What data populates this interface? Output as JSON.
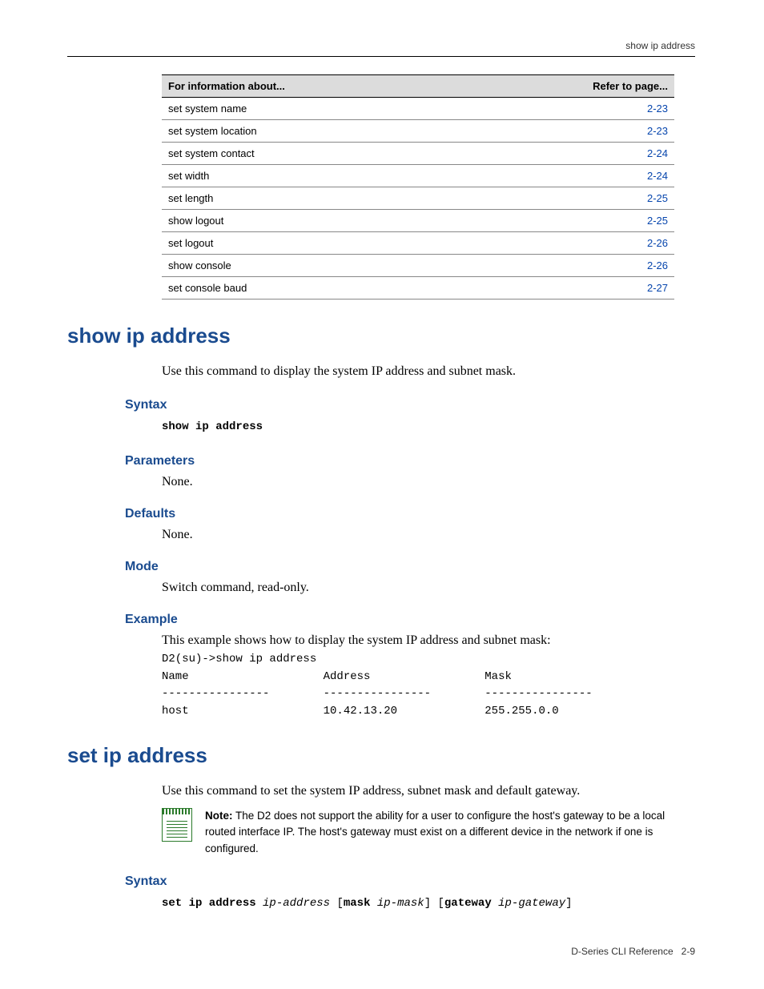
{
  "header": {
    "running_head": "show ip address"
  },
  "ref_table": {
    "col1": "For information about...",
    "col2": "Refer to page...",
    "rows": [
      {
        "info": "set system name",
        "page": "2-23"
      },
      {
        "info": "set system location",
        "page": "2-23"
      },
      {
        "info": "set system contact",
        "page": "2-24"
      },
      {
        "info": "set width",
        "page": "2-24"
      },
      {
        "info": "set length",
        "page": "2-25"
      },
      {
        "info": "show logout",
        "page": "2-25"
      },
      {
        "info": "set logout",
        "page": "2-26"
      },
      {
        "info": "show console",
        "page": "2-26"
      },
      {
        "info": "set console baud",
        "page": "2-27"
      }
    ]
  },
  "sections": {
    "show_ip": {
      "title": "show ip address",
      "desc": "Use this command to display the system IP address and subnet mask.",
      "syntax_h": "Syntax",
      "syntax_code": "show ip address",
      "params_h": "Parameters",
      "params_body": "None.",
      "defaults_h": "Defaults",
      "defaults_body": "None.",
      "mode_h": "Mode",
      "mode_body": "Switch command, read-only.",
      "example_h": "Example",
      "example_intro": "This example shows how to display the system IP address and subnet mask:",
      "example_output": "D2(su)->show ip address\nName                    Address                 Mask\n----------------        ----------------        ----------------\nhost                    10.42.13.20             255.255.0.0"
    },
    "set_ip": {
      "title": "set ip address",
      "desc": "Use this command to set the system IP address, subnet mask and default gateway.",
      "note_label": "Note:",
      "note_body": "The D2 does not support the ability for a user to configure the host's gateway to be a local routed interface IP. The host's gateway must exist on a different device in the network if one is configured.",
      "syntax_h": "Syntax",
      "syntax": {
        "cmd": "set ip address",
        "arg1": "ip-address",
        "lb1": "[",
        "kw2": "mask",
        "arg2": "ip-mask",
        "rb1": "]",
        "lb2": "[",
        "kw3": "gateway",
        "arg3": "ip-gateway",
        "rb2": "]"
      }
    }
  },
  "footer": {
    "left": "D-Series CLI Reference",
    "right": "2-9"
  }
}
